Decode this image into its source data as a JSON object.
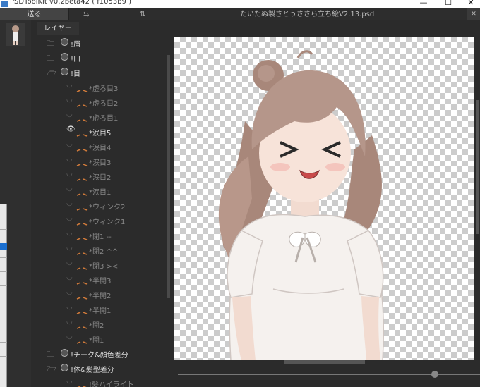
{
  "window": {
    "app_title": "PSDToolKit v0.2beta42 ( f1053b9 )",
    "minimize": "—",
    "maximize": "☐",
    "close": "✕"
  },
  "toolbar": {
    "send_label": "送る",
    "icon_a": "⇆",
    "icon_b": "⇅",
    "document_title": "たいたぬ製さとうささら立ち絵V2.13.psd",
    "close_label": "✕"
  },
  "tabs": {
    "layers": "レイヤー"
  },
  "layers": [
    {
      "label": "!眉",
      "kind": "group",
      "state": "closed",
      "indent": 0,
      "visible": false,
      "selected": false
    },
    {
      "label": "!口",
      "kind": "group",
      "state": "closed",
      "indent": 0,
      "visible": false,
      "selected": false
    },
    {
      "label": "!目",
      "kind": "group",
      "state": "open",
      "indent": 0,
      "visible": false,
      "selected": false
    },
    {
      "label": "*虚ろ目3",
      "kind": "layer",
      "indent": 1,
      "visible": false,
      "selected": false
    },
    {
      "label": "*虚ろ目2",
      "kind": "layer",
      "indent": 1,
      "visible": false,
      "selected": false
    },
    {
      "label": "*虚ろ目1",
      "kind": "layer",
      "indent": 1,
      "visible": false,
      "selected": false
    },
    {
      "label": "*涙目5",
      "kind": "layer",
      "indent": 1,
      "visible": true,
      "selected": true
    },
    {
      "label": "*涙目4",
      "kind": "layer",
      "indent": 1,
      "visible": false,
      "selected": false
    },
    {
      "label": "*涙目3",
      "kind": "layer",
      "indent": 1,
      "visible": false,
      "selected": false
    },
    {
      "label": "*涙目2",
      "kind": "layer",
      "indent": 1,
      "visible": false,
      "selected": false
    },
    {
      "label": "*涙目1",
      "kind": "layer",
      "indent": 1,
      "visible": false,
      "selected": false
    },
    {
      "label": "*ウィンク2",
      "kind": "layer",
      "indent": 1,
      "visible": false,
      "selected": false
    },
    {
      "label": "*ウィンク1",
      "kind": "layer",
      "indent": 1,
      "visible": false,
      "selected": false
    },
    {
      "label": "*閉1 --",
      "kind": "layer",
      "indent": 1,
      "visible": false,
      "selected": false
    },
    {
      "label": "*閉2 ^^",
      "kind": "layer",
      "indent": 1,
      "visible": false,
      "selected": false
    },
    {
      "label": "*閉3 ><",
      "kind": "layer",
      "indent": 1,
      "visible": false,
      "selected": false
    },
    {
      "label": "*半開3",
      "kind": "layer",
      "indent": 1,
      "visible": false,
      "selected": false
    },
    {
      "label": "*半開2",
      "kind": "layer",
      "indent": 1,
      "visible": false,
      "selected": false
    },
    {
      "label": "*半開1",
      "kind": "layer",
      "indent": 1,
      "visible": false,
      "selected": false
    },
    {
      "label": "*開2",
      "kind": "layer",
      "indent": 1,
      "visible": false,
      "selected": false
    },
    {
      "label": "*開1",
      "kind": "layer",
      "indent": 1,
      "visible": false,
      "selected": false
    },
    {
      "label": "!チーク&顔色差分",
      "kind": "group",
      "state": "closed",
      "indent": 0,
      "visible": false,
      "selected": false
    },
    {
      "label": "!体&髪型差分",
      "kind": "group",
      "state": "open",
      "indent": 0,
      "visible": false,
      "selected": false
    },
    {
      "label": "!髪ハイライト",
      "kind": "layer",
      "indent": 1,
      "visible": false,
      "selected": false
    }
  ],
  "zoom_slider": {
    "fraction": 0.86
  },
  "colors": {
    "panel": "#2b2b2b",
    "accent_blue": "#1a6fd1"
  }
}
